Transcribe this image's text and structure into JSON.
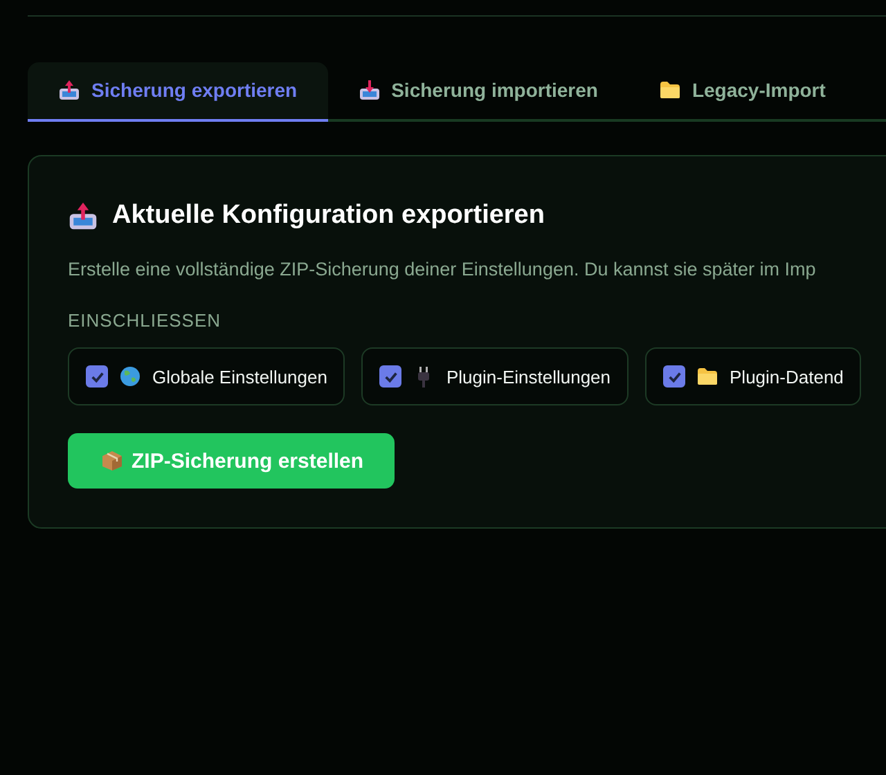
{
  "tabs": [
    {
      "label": "Sicherung exportieren",
      "selected": true
    },
    {
      "label": "Sicherung importieren",
      "selected": false
    },
    {
      "label": "Legacy-Import",
      "selected": false
    }
  ],
  "panel": {
    "title": "Aktuelle Konfiguration exportieren",
    "description": "Erstelle eine vollständige ZIP-Sicherung deiner Einstellungen. Du kannst sie später im Imp",
    "include_label": "EINSCHLIESSEN",
    "options": [
      {
        "label": "Globale Einstellungen",
        "checked": true
      },
      {
        "label": "Plugin-Einstellungen",
        "checked": true
      },
      {
        "label": "Plugin-Datend",
        "checked": true
      }
    ],
    "button": "ZIP-Sicherung erstellen"
  }
}
